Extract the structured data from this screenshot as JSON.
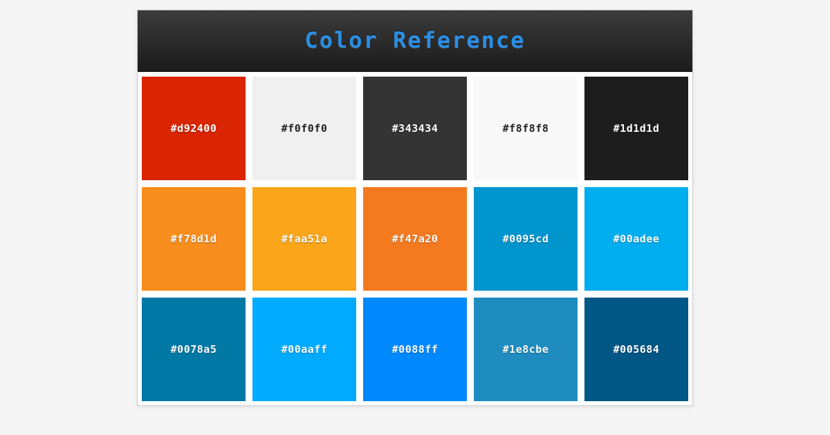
{
  "header": {
    "title": "Color Reference"
  },
  "swatches": [
    {
      "hex": "#d92400",
      "labelLight": true
    },
    {
      "hex": "#f0f0f0",
      "labelLight": false
    },
    {
      "hex": "#343434",
      "labelLight": true
    },
    {
      "hex": "#f8f8f8",
      "labelLight": false
    },
    {
      "hex": "#1d1d1d",
      "labelLight": true
    },
    {
      "hex": "#f78d1d",
      "labelLight": true
    },
    {
      "hex": "#faa51a",
      "labelLight": true
    },
    {
      "hex": "#f47a20",
      "labelLight": true
    },
    {
      "hex": "#0095cd",
      "labelLight": true
    },
    {
      "hex": "#00adee",
      "labelLight": true
    },
    {
      "hex": "#0078a5",
      "labelLight": true
    },
    {
      "hex": "#00aaff",
      "labelLight": true
    },
    {
      "hex": "#0088ff",
      "labelLight": true
    },
    {
      "hex": "#1e8cbe",
      "labelLight": true
    },
    {
      "hex": "#005684",
      "labelLight": true
    }
  ]
}
